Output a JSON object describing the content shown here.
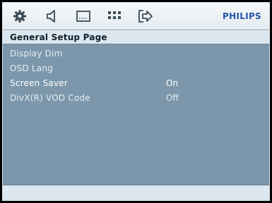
{
  "toolbar": {
    "icons": [
      "gear-icon",
      "speaker-icon",
      "display-icon",
      "grid-icon",
      "exit-icon"
    ],
    "brand": "PHILIPS"
  },
  "page": {
    "title": "General Setup Page"
  },
  "menu": {
    "items": [
      {
        "label": "Display Dim",
        "value": ""
      },
      {
        "label": "OSD Lang",
        "value": ""
      },
      {
        "label": "Screen Saver",
        "value": "On"
      },
      {
        "label": "DivX(R) VOD Code",
        "value": "Off"
      }
    ],
    "selected_index": 2
  },
  "status": {
    "text": ""
  },
  "colors": {
    "background": "#7c97ab",
    "topbar": "#eef3f6",
    "icon": "#3a4a56",
    "brand": "#2555a5"
  }
}
